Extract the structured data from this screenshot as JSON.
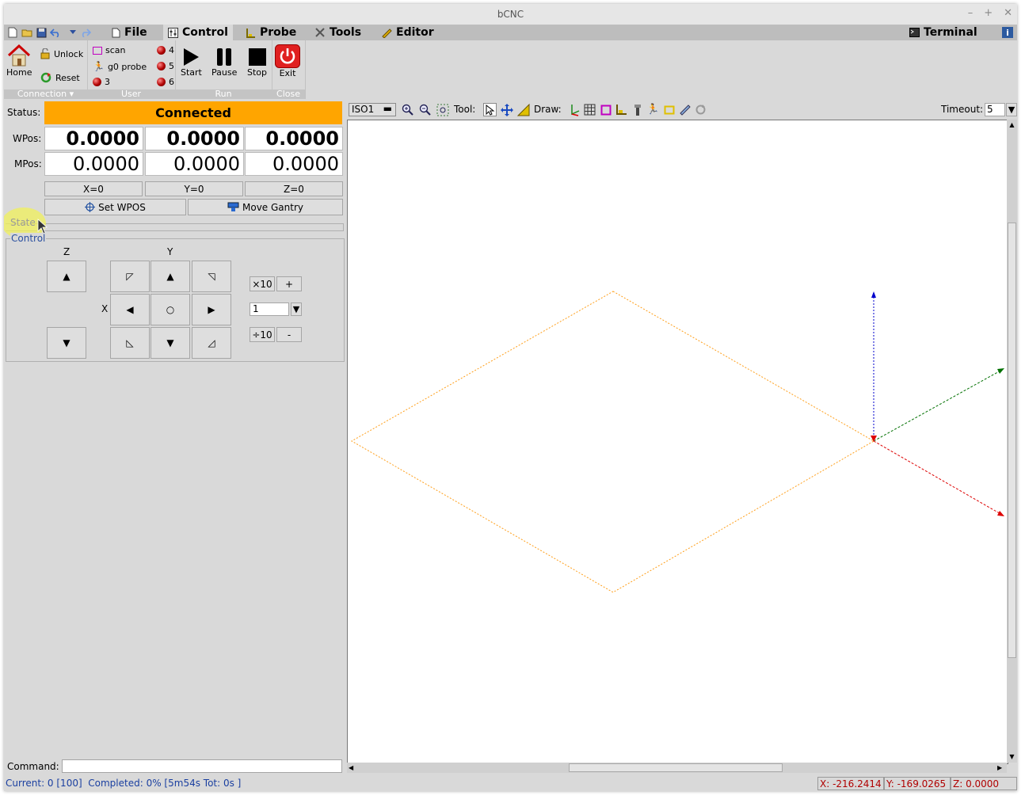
{
  "window": {
    "title": "bCNC"
  },
  "menu": {
    "tabs": [
      {
        "label": "File"
      },
      {
        "label": "Control"
      },
      {
        "label": "Probe"
      },
      {
        "label": "Tools"
      },
      {
        "label": "Editor"
      }
    ],
    "terminal": "Terminal"
  },
  "ribbon": {
    "connection": {
      "home": "Home",
      "unlock": "Unlock",
      "reset": "Reset",
      "group": "Connection"
    },
    "user": {
      "scan": "scan",
      "g0probe": "g0 probe",
      "b3": "3",
      "b4": "4",
      "b5": "5",
      "b6": "6",
      "group": "User"
    },
    "run": {
      "start": "Start",
      "pause": "Pause",
      "stop": "Stop",
      "group": "Run"
    },
    "close": {
      "exit": "Exit",
      "group": "Close"
    }
  },
  "state": {
    "status_label": "Status:",
    "status": "Connected",
    "status_color": "#ffa500",
    "wpos_label": "WPos:",
    "mpos_label": "MPos:",
    "wpos": {
      "x": "0.0000",
      "y": "0.0000",
      "z": "0.0000"
    },
    "mpos": {
      "x": "0.0000",
      "y": "0.0000",
      "z": "0.0000"
    },
    "zero": {
      "x": "X=0",
      "y": "Y=0",
      "z": "Z=0"
    },
    "set_wpos": "Set WPOS",
    "move_gantry": "Move Gantry",
    "state_section": "State",
    "control_section": "Control"
  },
  "jog": {
    "z_label": "Z",
    "y_label": "Y",
    "x_label": "X",
    "times10": "×10",
    "plus": "+",
    "div10": "÷10",
    "minus": "-",
    "step": "1"
  },
  "canvasbar": {
    "view": "ISO1",
    "tool_label": "Tool:",
    "draw_label": "Draw:",
    "timeout_label": "Timeout:",
    "timeout": "5"
  },
  "command": {
    "label": "Command:",
    "value": ""
  },
  "statusline": {
    "text": "Current: 0 [100]  Completed: 0% [5m54s Tot: 0s ]",
    "x": "X: -216.2414",
    "y": "Y: -169.0265",
    "z": "Z: 0.0000"
  }
}
